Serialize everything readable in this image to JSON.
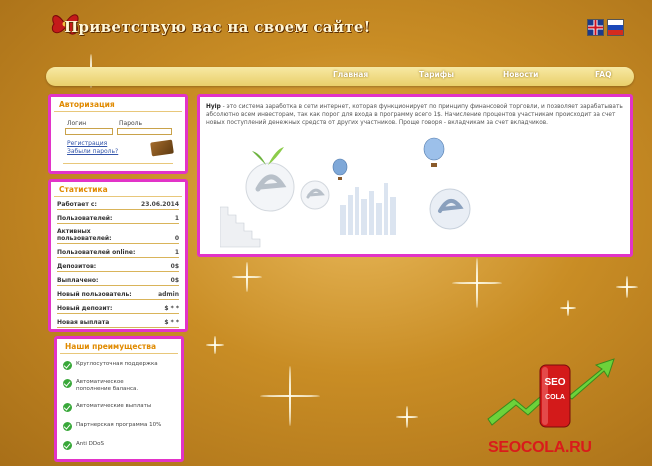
{
  "header": {
    "site_title": "Приветствую вас на своем сайте!",
    "languages": [
      {
        "code": "en",
        "icon": "uk-flag-icon"
      },
      {
        "code": "ru",
        "icon": "ru-flag-icon"
      }
    ]
  },
  "nav": {
    "items": [
      "Главная",
      "Тарифы",
      "Новости",
      "FAQ"
    ]
  },
  "auth": {
    "title": "Авторизация",
    "login_label": "Логин",
    "password_label": "Пароль",
    "register_link": "Регистрация",
    "forgot_link": "Забыли пароль?"
  },
  "stats": {
    "title": "Статистика",
    "rows": [
      {
        "label": "Работает с:",
        "value": "23.06.2014"
      },
      {
        "label": "Пользователей:",
        "value": "1"
      },
      {
        "label": "Активных пользователей:",
        "value": "0"
      },
      {
        "label": "Пользователей online:",
        "value": "1"
      },
      {
        "label": "Депозитов:",
        "value": "0$"
      },
      {
        "label": "Выплачено:",
        "value": "0$"
      },
      {
        "label": "Новый пользователь:",
        "value": "admin"
      },
      {
        "label": "Новый депозит:",
        "value": "$ * *"
      },
      {
        "label": "Новая выплата",
        "value": "$ * *"
      }
    ]
  },
  "advantages": {
    "title": "Наши преимущества",
    "items": [
      "Круглосуточная поддержка",
      "Автоматическое пополнение баланса.",
      "Автоматические выплаты",
      "Партнерская программа 10%",
      "Anti DDoS"
    ]
  },
  "content": {
    "brand": "Hyip",
    "intro": " - это система заработка в сети интернет, которая функционирует по принципу финансовой торговли, и позволяет зарабатывать абсолютно всем инвесторам, так как порог для входа в программу всего 1$. Начисление процентов участникам происходит за счет новых поступлений денежных средств от других участников. Проще говоря - вкладчикам за счет вкладчиков."
  },
  "watermark": {
    "can_text": "SEO COLA",
    "site": "SEOCOLA.RU"
  },
  "colors": {
    "panel_border": "#e233c8",
    "title_orange": "#e08a00",
    "accent_red": "#d91b1b"
  }
}
